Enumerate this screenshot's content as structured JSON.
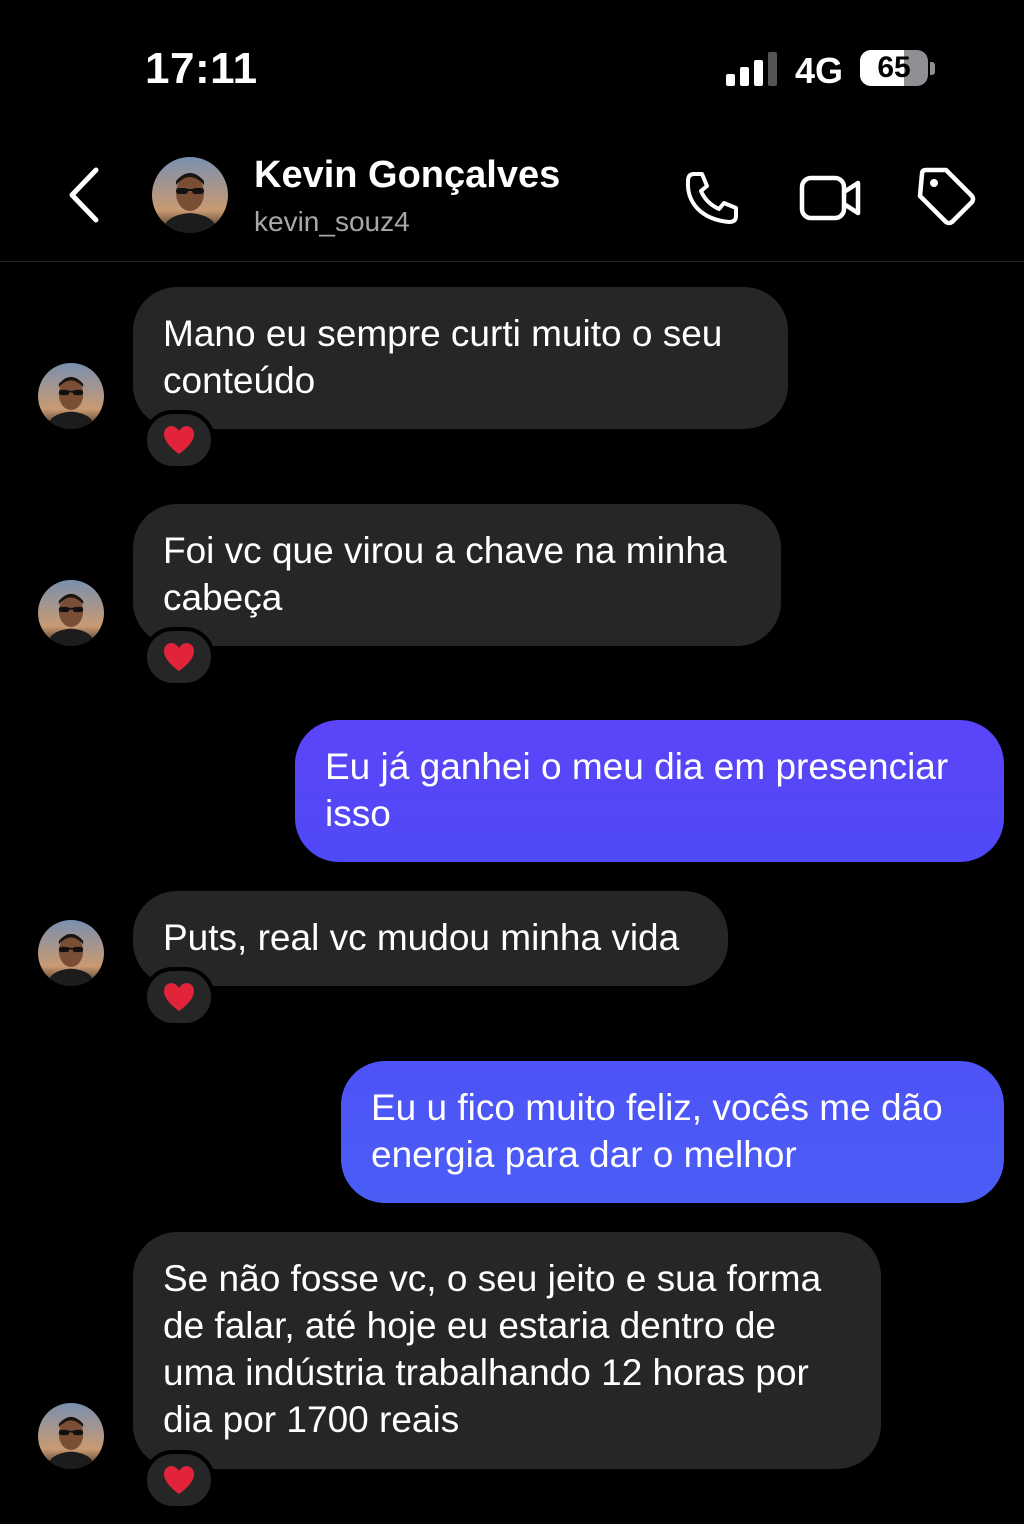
{
  "status_bar": {
    "time": "17:11",
    "network": "4G",
    "battery_percent": "65",
    "battery_level": 0.65
  },
  "header": {
    "back_icon": "chevron-left-icon",
    "name": "Kevin Gonçalves",
    "username": "kevin_souz4",
    "call_icon": "phone-icon",
    "video_icon": "video-camera-icon",
    "tag_icon": "tag-icon"
  },
  "colors": {
    "background": "#000000",
    "received_bubble": "#262626",
    "sent_bubble_top": "#5b45f8",
    "sent_bubble_bottom": "#4a5ef6",
    "reaction_heart": "#e2243b"
  },
  "messages": [
    {
      "side": "received",
      "lines": [
        "Mano eu sempre curti muito o seu",
        "conteúdo"
      ],
      "reaction": "❤️"
    },
    {
      "side": "received",
      "lines": [
        "Foi vc que virou a chave na minha",
        "cabeça"
      ],
      "reaction": "❤️"
    },
    {
      "side": "sent",
      "lines": [
        "Eu já ganhei o meu dia em presenciar",
        "isso"
      ]
    },
    {
      "side": "received",
      "lines": [
        "Puts, real vc mudou minha vida"
      ],
      "reaction": "❤️"
    },
    {
      "side": "sent",
      "lines": [
        "Eu u fico muito feliz, vocês me dão",
        "energia para dar o melhor"
      ]
    },
    {
      "side": "received",
      "lines": [
        "Se não fosse vc, o seu jeito e sua forma",
        "de falar, até hoje eu estaria dentro de",
        "uma indústria trabalhando 12 horas por",
        "dia por 1700 reais"
      ],
      "reaction": "❤️"
    }
  ]
}
